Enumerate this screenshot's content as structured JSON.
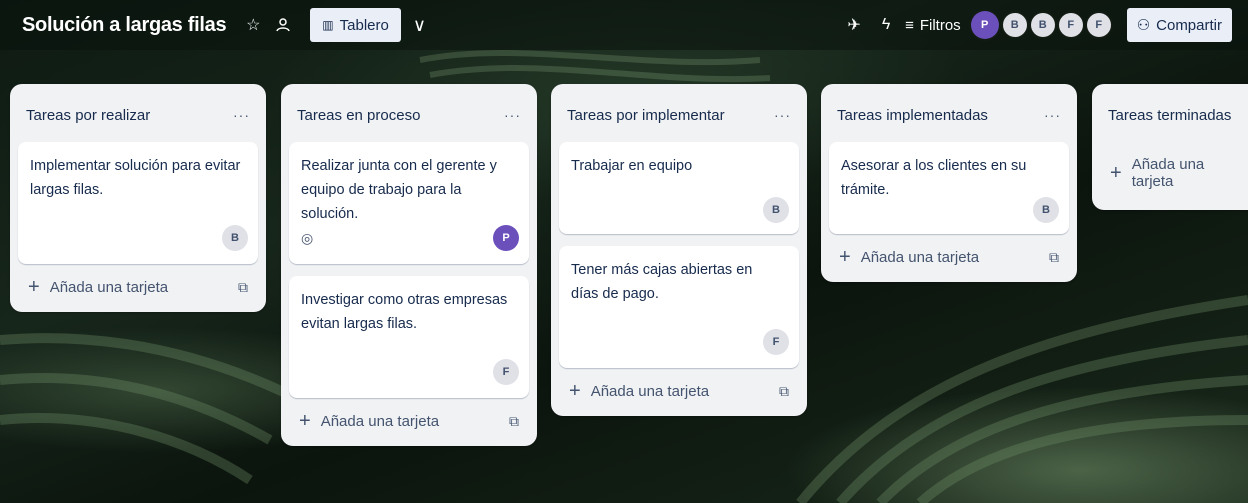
{
  "board": {
    "title": "Solución a largas filas",
    "view_label": "Tablero",
    "filters_label": "Filtros",
    "share_label": "Compartir",
    "members": [
      "P",
      "B",
      "B",
      "F",
      "F"
    ]
  },
  "lists": [
    {
      "title": "Tareas por realizar",
      "menu": "···",
      "cards": [
        {
          "text": "Implementar solución para evitar largas filas.",
          "member": "B"
        }
      ],
      "add_label": "Añada una tarjeta"
    },
    {
      "title": "Tareas en proceso",
      "menu": "···",
      "cards": [
        {
          "text": "Realizar junta con el gerente y equipo de trabajo para la solución.",
          "member": "P"
        },
        {
          "text": "Investigar como otras empresas evitan largas filas.",
          "member": "F"
        }
      ],
      "add_label": "Añada una tarjeta"
    },
    {
      "title": "Tareas por implementar",
      "menu": "···",
      "cards": [
        {
          "text": "Trabajar en equipo",
          "member": "B"
        },
        {
          "text": "Tener más cajas abiertas en días de pago.",
          "member": "F"
        }
      ],
      "add_label": "Añada una tarjeta"
    },
    {
      "title": "Tareas implementadas",
      "menu": "···",
      "cards": [
        {
          "text": "Asesorar a los clientes en su trámite.",
          "member": "B"
        }
      ],
      "add_label": "Añada una tarjeta"
    },
    {
      "title": "Tareas terminadas",
      "cards": [],
      "add_label": "Añada una tarjeta"
    }
  ]
}
